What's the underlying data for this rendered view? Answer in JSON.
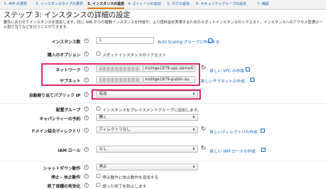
{
  "tabs": [
    "1. AMI の選択",
    "2. インスタンスタイプの選択",
    "3. インスタンスの設定",
    "4. ストレージの追加",
    "5. タグの追加",
    "6. セキュリティグループの設定",
    "7. 確認"
  ],
  "header": {
    "title": "ステップ 3: インスタンスの詳細の設定",
    "description": "要件に合わせてインスタンスを設定します。同じ AMI からの複数インスタンスを作成や、より低料金を実現するためのスポットインスタンスのリクエスト、インスタンスへのアクセス管理ロール割り当てなどを行うことができます。"
  },
  "form": {
    "instance_count": {
      "label": "インスタンス数",
      "value": "1",
      "link": "Auto Scaling グループに作成する"
    },
    "purchase_option": {
      "label": "購入のオプション",
      "checkbox_label": "スポットインスタンスのリクエスト"
    },
    "network": {
      "label": "ネットワーク",
      "value": "| mshige1979-vpc-demo0",
      "link": "新しい VPC の作成"
    },
    "subnet": {
      "label": "サブネット",
      "value": "| mshige1979-public-su",
      "link": "新しいサブネットの作成"
    },
    "auto_public_ip": {
      "label": "自動割り当てパブリック IP",
      "value": "有効"
    },
    "placement_group": {
      "label": "配置グループ",
      "checkbox_label": "インスタンスをプレイスメントグループに追加します。"
    },
    "capacity_reservation": {
      "label": "キャパシティーの予約",
      "value": "開く"
    },
    "domain_directory": {
      "label": "ドメイン結合ディレクトリ",
      "value": "ディレクトリなし",
      "link": "新しいディレクトリの作成"
    },
    "iam_role": {
      "label": "IAM ロール",
      "value": "なし",
      "link": "新しい IAM ロールの作成"
    },
    "shutdown_behavior": {
      "label": "シャットダウン動作",
      "value": "停止"
    },
    "stop_hibernate": {
      "label": "停止 - 休止動作",
      "checkbox_label": "停止動作に休止動作を追加する"
    },
    "termination_protection": {
      "label": "終了保護の有効化",
      "checkbox_label": "誤った終了を防止します"
    }
  },
  "colors": {
    "highlight": "#e0245e",
    "link": "#1166bb",
    "active_tab_underline": "#e8780a"
  },
  "icons": {
    "info": "info-icon",
    "refresh": "refresh-icon",
    "external": "external-link-icon",
    "dropdown": "chevron-down-icon"
  }
}
